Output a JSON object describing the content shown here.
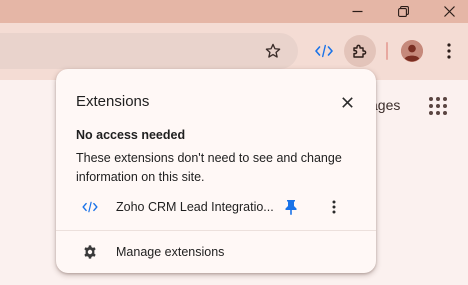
{
  "window": {
    "controls": {
      "minimize_icon": "minimize-icon",
      "restore_icon": "restore-icon",
      "close_icon": "close-icon"
    }
  },
  "toolbar": {
    "bookmark_icon": "star-icon",
    "extension_icon": "code-icon",
    "extensions_icon": "puzzle-icon",
    "profile_icon": "avatar",
    "menu_icon": "kebab-icon"
  },
  "page": {
    "partial_text": "ages"
  },
  "popup": {
    "title": "Extensions",
    "section_heading": "No access needed",
    "section_description": "These extensions don't need to see and change information on this site.",
    "extensions": [
      {
        "name": "Zoho CRM Lead Integratio...",
        "icon": "code-icon",
        "pinned": true
      }
    ],
    "manage_label": "Manage extensions"
  },
  "colors": {
    "titlebar": "#e5b6a6",
    "toolbar": "#f4dcd4",
    "accent_blue": "#1a73e8",
    "popup_bg": "#fff8f6"
  }
}
